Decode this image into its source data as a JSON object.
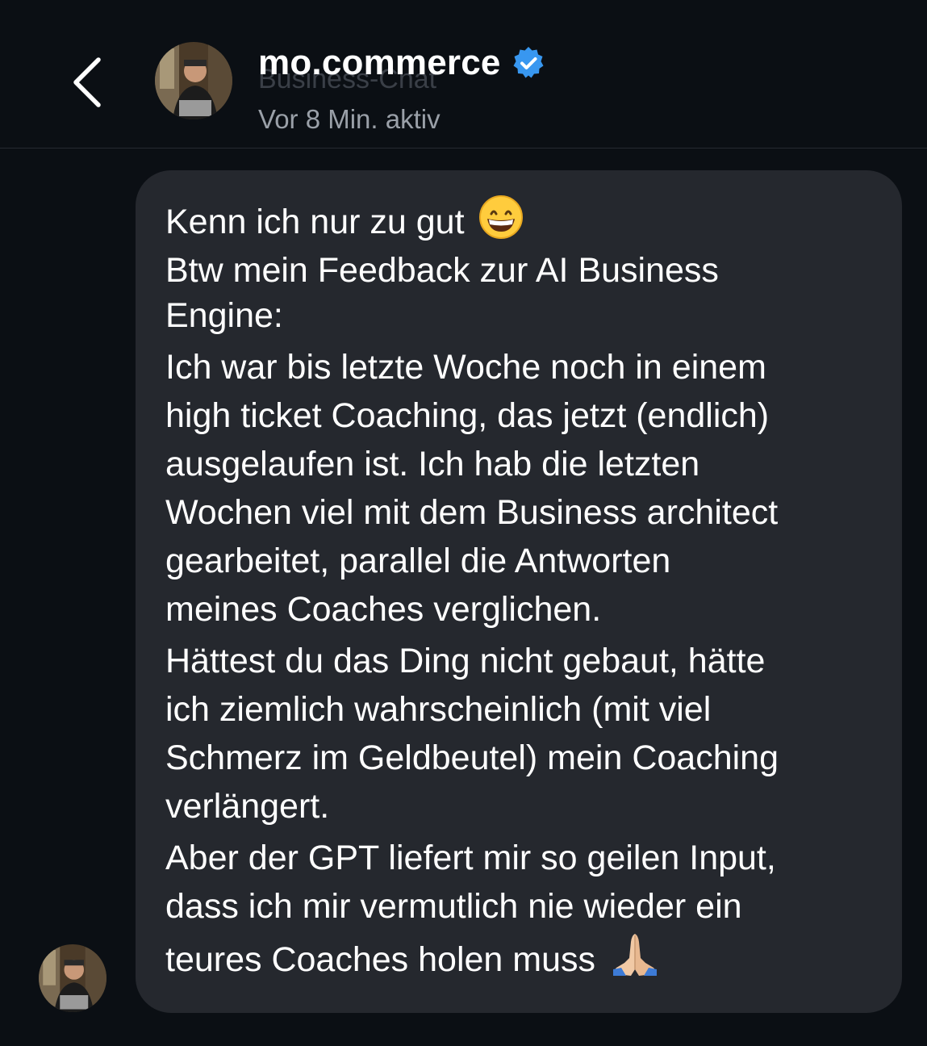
{
  "header": {
    "back_icon": "chevron-left-icon",
    "contact_name": "mo.commerce",
    "verified_icon": "verified-badge-icon",
    "verified_color": "#3897f0",
    "subtitle": "Business-Chat",
    "status": "Vor 8 Min. aktiv"
  },
  "message": {
    "lines": [
      "Kenn ich nur zu gut",
      "Btw mein Feedback zur AI Business",
      "Engine:",
      "Ich war bis letzte Woche noch in einem",
      "high ticket Coaching, das jetzt (endlich)",
      "ausgelaufen ist. Ich hab die letzten",
      "Wochen viel mit dem Business architect",
      "gearbeitet, parallel die Antworten",
      "meines Coaches verglichen.",
      "Hättest du das Ding nicht gebaut, hätte",
      "ich ziemlich wahrscheinlich (mit viel",
      "Schmerz im Geldbeutel) mein Coaching",
      "verlängert.",
      "Aber der GPT liefert mir so geilen Input,",
      "dass ich mir vermutlich nie wieder ein",
      "teures Coaches holen muss"
    ],
    "emoji_1": "grinning-face-icon",
    "emoji_2": "folded-hands-icon",
    "bubble_color": "#25282e"
  }
}
